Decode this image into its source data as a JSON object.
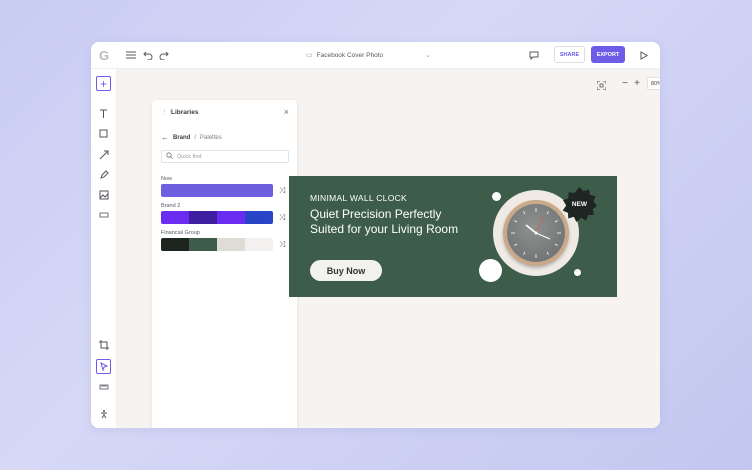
{
  "app": {
    "logo": "G",
    "doc_title": "Facebook Cover Photo",
    "share_label": "SHARE",
    "export_label": "EXPORT",
    "accent": "#6c5ce7"
  },
  "toolbar_icons": [
    "menu-icon",
    "undo-icon",
    "redo-icon",
    "comment-icon",
    "play-icon"
  ],
  "left_tools": [
    "add-icon",
    "text-icon",
    "shape-icon",
    "line-icon",
    "pen-icon",
    "image-icon",
    "more-icon",
    "crop-icon",
    "pointer-icon",
    "ruler-icon",
    "accessibility-icon"
  ],
  "libraries": {
    "title": "Libraries",
    "breadcrumb": {
      "parent": "Brand",
      "separator": "/",
      "current": "Palettes"
    },
    "search_placeholder": "Quick find",
    "palettes": [
      {
        "name": "Now",
        "colors": [
          "#6e5ee0"
        ]
      },
      {
        "name": "Brand 2",
        "colors": [
          "#6a2cf0",
          "#3d1fa0",
          "#6a2cf0",
          "#2a44c8"
        ]
      },
      {
        "name": "Financial Group",
        "colors": [
          "#1c2420",
          "#3d5d4a",
          "#dfdcd6",
          "#f2f1ef"
        ]
      }
    ]
  },
  "zoom": {
    "minus": "−",
    "plus": "+",
    "value": "80%"
  },
  "banner": {
    "eyebrow": "MINIMAL WALL CLOCK",
    "headline": "Quiet Precision Perfectly Suited for your Living Room",
    "cta": "Buy Now",
    "badge": "NEW",
    "bg_color": "#3d5d4a"
  }
}
